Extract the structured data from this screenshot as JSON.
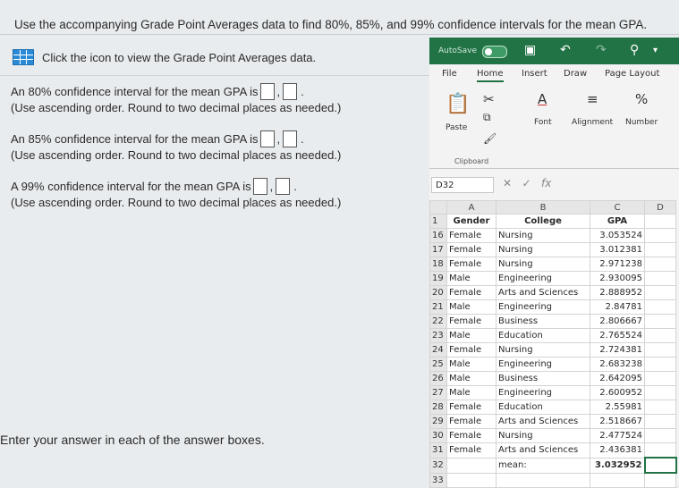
{
  "question": "Use the accompanying Grade Point Averages data to find 80%, 85%, and 99% confidence intervals for the mean GPA.",
  "data_link": {
    "icon": "grid-icon",
    "label": "Click the icon to view the Grade Point Averages data."
  },
  "intervals": [
    {
      "prompt": "An 80% confidence interval for the mean GPA is",
      "note": "(Use ascending order. Round to two decimal places as needed.)"
    },
    {
      "prompt": "An 85% confidence interval for the mean GPA is",
      "note": "(Use ascending order. Round to two decimal places as needed.)"
    },
    {
      "prompt": "A 99% confidence interval for the mean GPA is",
      "note": "(Use ascending order. Round to two decimal places as needed.)"
    }
  ],
  "footer": "Enter your answer in each of the answer boxes.",
  "excel": {
    "autosave": "AutoSave",
    "toggle": "Off",
    "menu": [
      "File",
      "Home",
      "Insert",
      "Draw",
      "Page Layout"
    ],
    "ribbon": {
      "paste": "Paste",
      "font": "Font",
      "alignment": "Alignment",
      "number": "Number",
      "clipboard": "Clipboard"
    },
    "name_box": "D32",
    "fx": "fx",
    "columns": [
      "A",
      "B",
      "C",
      "D"
    ],
    "header_row": {
      "num": "1",
      "gender": "Gender",
      "college": "College",
      "gpa": "GPA"
    },
    "rows": [
      {
        "num": "16",
        "gender": "Female",
        "college": "Nursing",
        "gpa": "3.053524"
      },
      {
        "num": "17",
        "gender": "Female",
        "college": "Nursing",
        "gpa": "3.012381"
      },
      {
        "num": "18",
        "gender": "Female",
        "college": "Nursing",
        "gpa": "2.971238"
      },
      {
        "num": "19",
        "gender": "Male",
        "college": "Engineering",
        "gpa": "2.930095"
      },
      {
        "num": "20",
        "gender": "Female",
        "college": "Arts and Sciences",
        "gpa": "2.888952"
      },
      {
        "num": "21",
        "gender": "Male",
        "college": "Engineering",
        "gpa": "2.84781"
      },
      {
        "num": "22",
        "gender": "Female",
        "college": "Business",
        "gpa": "2.806667"
      },
      {
        "num": "23",
        "gender": "Male",
        "college": "Education",
        "gpa": "2.765524"
      },
      {
        "num": "24",
        "gender": "Female",
        "college": "Nursing",
        "gpa": "2.724381"
      },
      {
        "num": "25",
        "gender": "Male",
        "college": "Engineering",
        "gpa": "2.683238"
      },
      {
        "num": "26",
        "gender": "Male",
        "college": "Business",
        "gpa": "2.642095"
      },
      {
        "num": "27",
        "gender": "Male",
        "college": "Engineering",
        "gpa": "2.600952"
      },
      {
        "num": "28",
        "gender": "Female",
        "college": "Education",
        "gpa": "2.55981"
      },
      {
        "num": "29",
        "gender": "Female",
        "college": "Arts and Sciences",
        "gpa": "2.518667"
      },
      {
        "num": "30",
        "gender": "Female",
        "college": "Nursing",
        "gpa": "2.477524"
      },
      {
        "num": "31",
        "gender": "Female",
        "college": "Arts and Sciences",
        "gpa": "2.436381"
      }
    ],
    "mean_row": {
      "num": "32",
      "label": "mean:",
      "value": "3.032952"
    },
    "last_row": "33"
  },
  "colors": {
    "excel_green": "#217346",
    "icon_blue": "#2b8ad6"
  }
}
